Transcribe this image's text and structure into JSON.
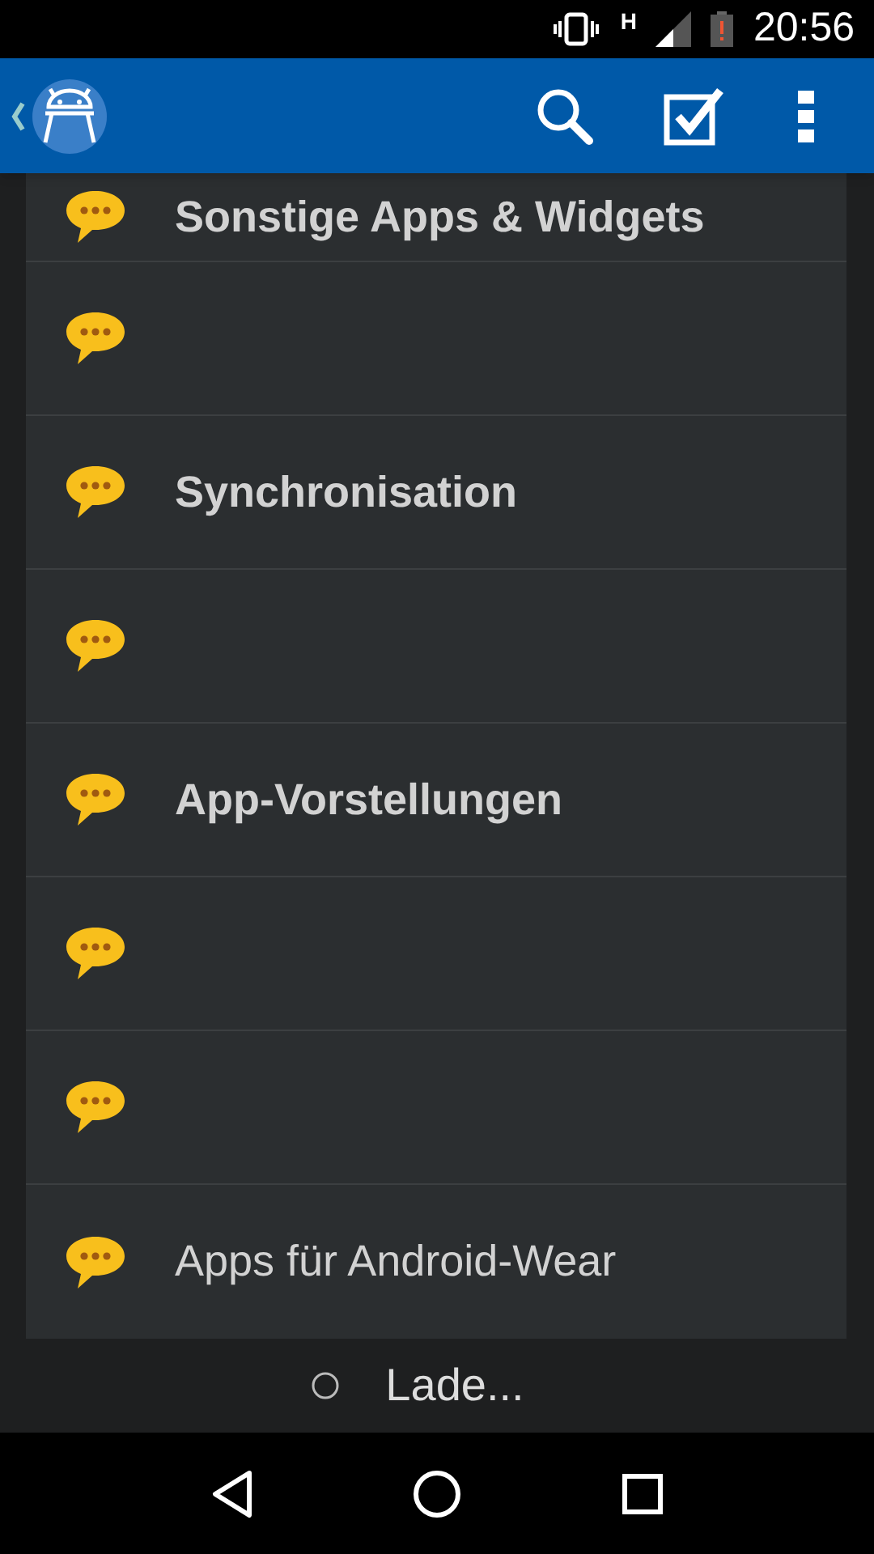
{
  "status_bar": {
    "network": "H",
    "time": "20:56"
  },
  "items": [
    {
      "kind": "titled",
      "title": "Sonstige Apps & Widgets",
      "bold": true
    },
    {
      "kind": "untitled"
    },
    {
      "kind": "titled",
      "title": "Synchronisation",
      "bold": true
    },
    {
      "kind": "untitled"
    },
    {
      "kind": "titled",
      "title": "App-Vorstellungen",
      "bold": true
    },
    {
      "kind": "untitled"
    },
    {
      "kind": "untitled"
    },
    {
      "kind": "titled",
      "title": "Apps für Android-Wear",
      "bold": false
    }
  ],
  "footer": {
    "loading": "Lade..."
  }
}
